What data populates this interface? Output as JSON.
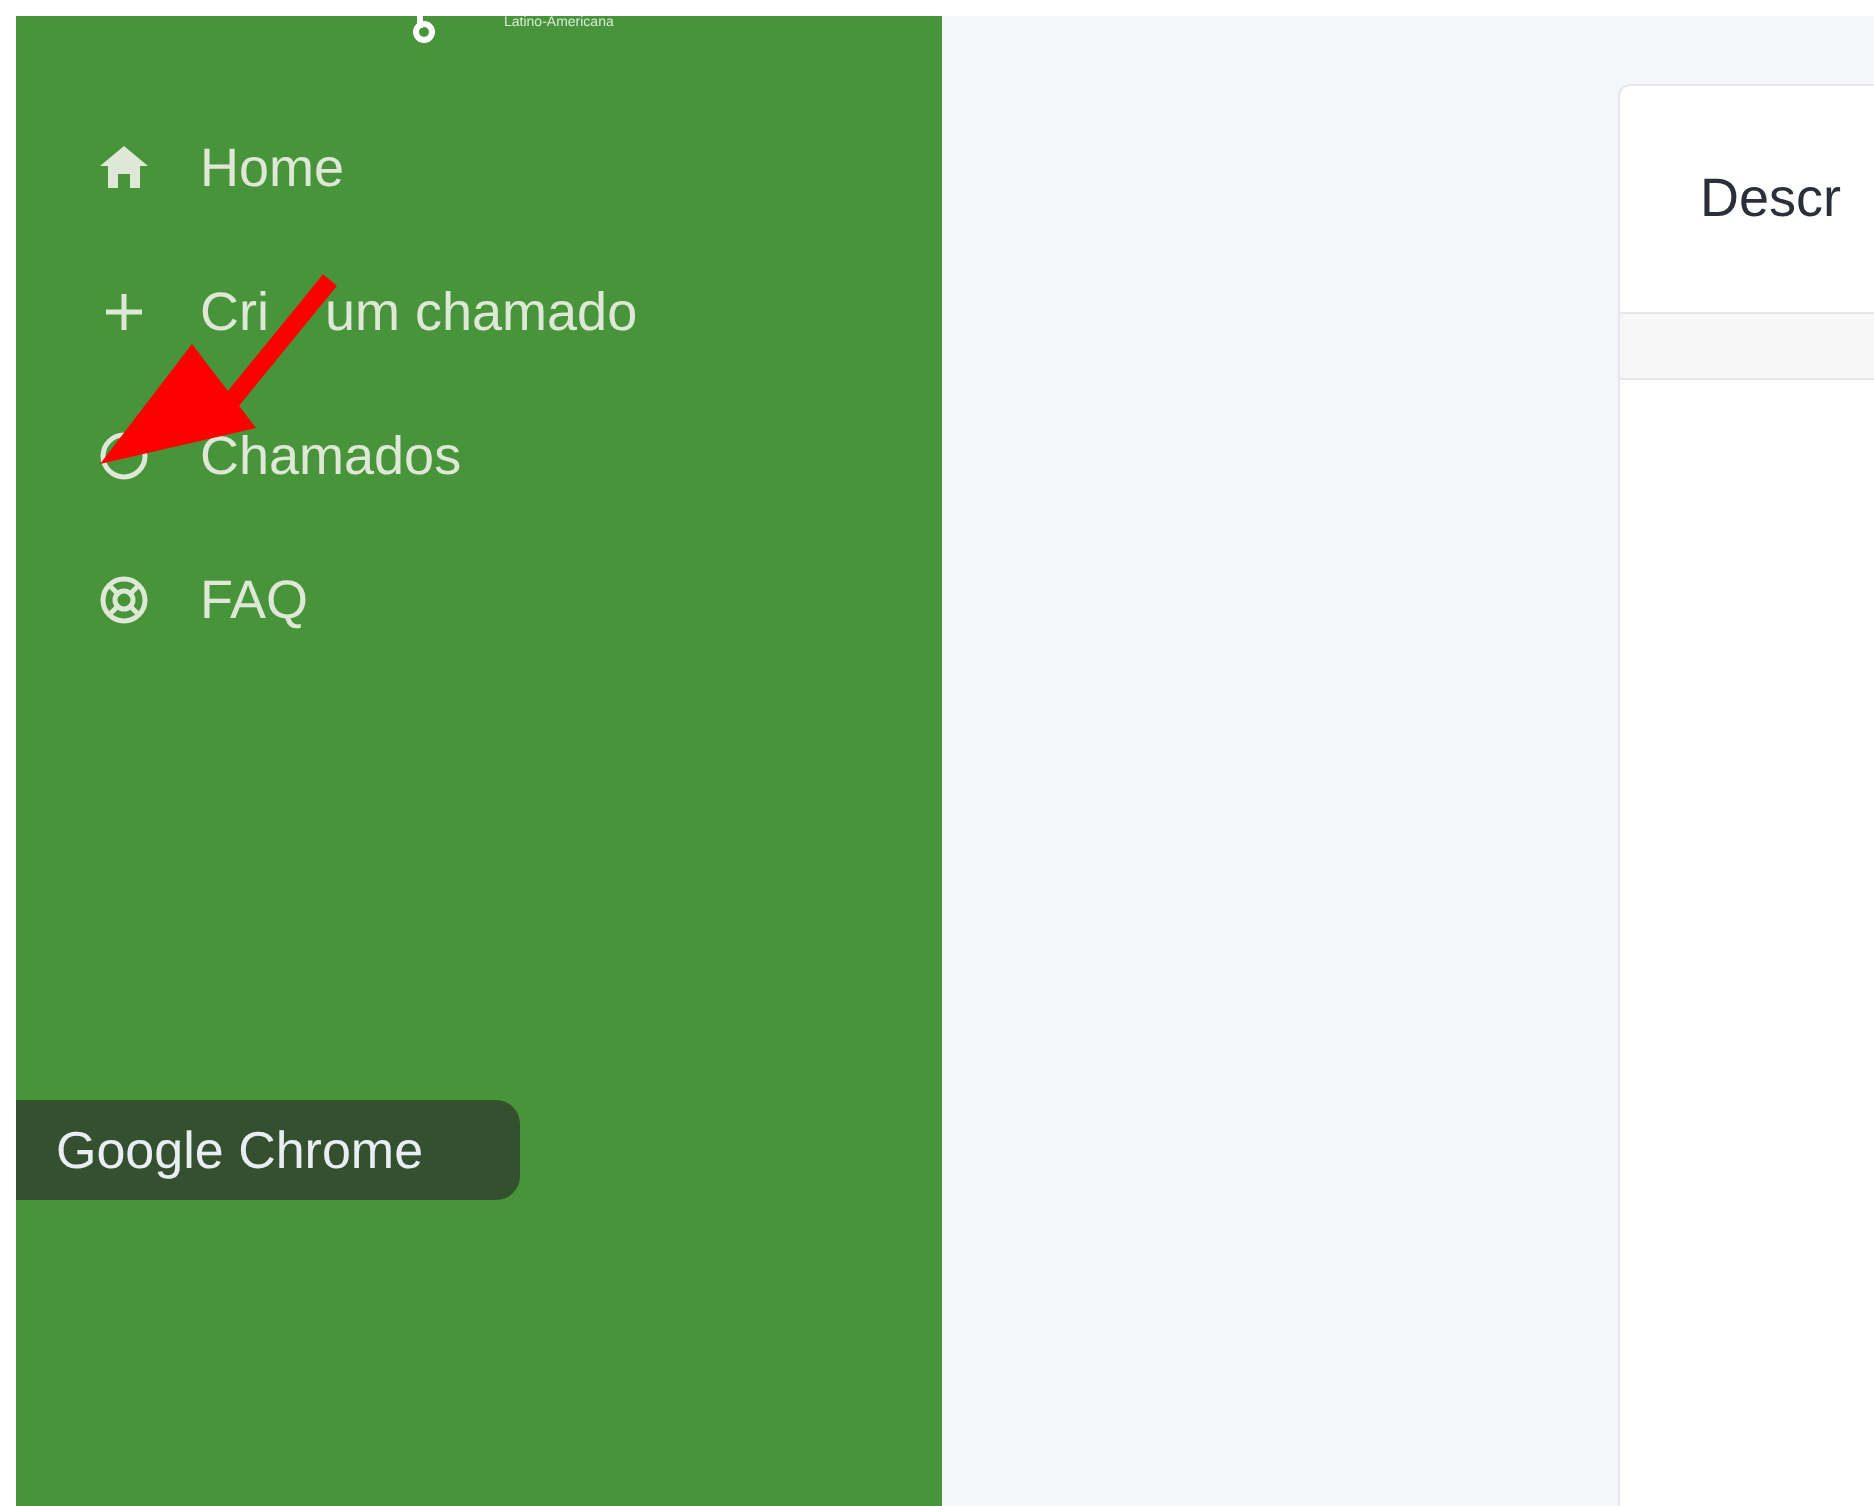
{
  "sidebar": {
    "logo_caption": "Latino-Americana",
    "items": [
      {
        "label": "Home"
      },
      {
        "label": "Cri",
        "label_after_cover": "um chamado"
      },
      {
        "label": "Chamados"
      },
      {
        "label": "FAQ"
      }
    ]
  },
  "tooltip": {
    "label": "Google Chrome"
  },
  "card": {
    "title": "Descr"
  },
  "annotation": {
    "kind": "arrow",
    "color": "#ff0000"
  }
}
